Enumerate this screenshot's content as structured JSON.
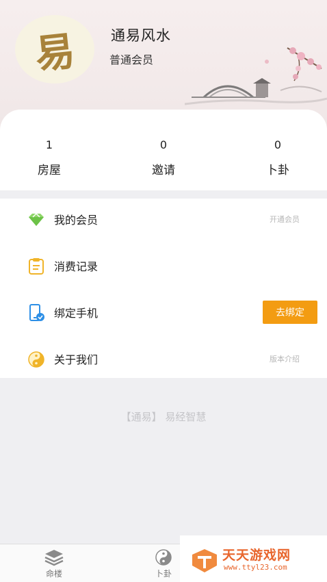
{
  "profile": {
    "avatar_char": "易",
    "app_title": "通易风水",
    "member_level": "普通会员"
  },
  "stats": [
    {
      "value": "1",
      "label": "房屋"
    },
    {
      "value": "0",
      "label": "邀请"
    },
    {
      "value": "0",
      "label": "卜卦"
    }
  ],
  "menu": {
    "membership": {
      "label": "我的会员",
      "hint": "开通会员",
      "icon": "diamond-icon"
    },
    "records": {
      "label": "消费记录",
      "icon": "clipboard-icon"
    },
    "bind_phone": {
      "label": "绑定手机",
      "button": "去绑定",
      "icon": "phone-icon"
    },
    "about": {
      "label": "关于我们",
      "hint": "版本介绍",
      "icon": "yin-yang-icon"
    }
  },
  "slogan": "【通易】 易经智慧",
  "tabbar": {
    "tabs": [
      {
        "label": "命楼",
        "icon": "layers-icon"
      },
      {
        "label": "卜卦",
        "icon": "yin-yang-icon"
      }
    ]
  },
  "watermark": {
    "title": "天天游戏网",
    "url": "www.ttyl23.com"
  },
  "colors": {
    "accent": "#f39c12",
    "header_bg": "#f3eaea",
    "watermark": "#e8652c"
  }
}
